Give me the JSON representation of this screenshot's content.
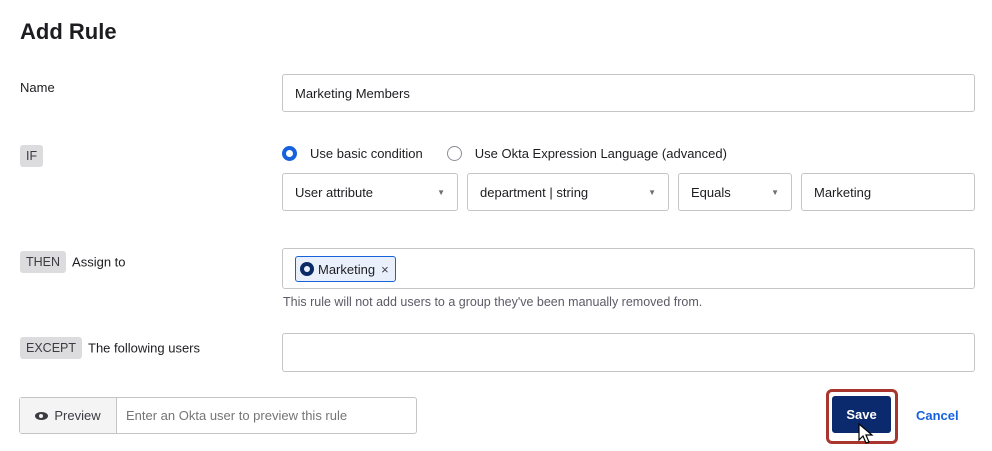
{
  "page": {
    "title": "Add Rule"
  },
  "name_row": {
    "label": "Name",
    "value": "Marketing Members"
  },
  "if_row": {
    "tag": "IF",
    "options": [
      {
        "label": "Use basic condition",
        "selected": true
      },
      {
        "label": "Use Okta Expression Language (advanced)",
        "selected": false
      }
    ],
    "attribute_type": "User attribute",
    "attribute": "department | string",
    "operator": "Equals",
    "value": "Marketing"
  },
  "then_row": {
    "tag": "THEN",
    "label": "Assign to",
    "group": "Marketing",
    "remove_symbol": "×",
    "hint": "This rule will not add users to a group they've been manually removed from."
  },
  "except_row": {
    "tag": "EXCEPT",
    "label": "The following users",
    "value": ""
  },
  "footer": {
    "preview_label": "Preview",
    "preview_placeholder": "Enter an Okta user to preview this rule",
    "save_label": "Save",
    "cancel_label": "Cancel"
  },
  "colors": {
    "primary": "#0b2a6d",
    "accent": "#1662dd",
    "highlight": "#a8362e"
  },
  "icons": {
    "preview": "eye-icon",
    "group": "group-icon",
    "dropdown": "caret-down-icon"
  }
}
